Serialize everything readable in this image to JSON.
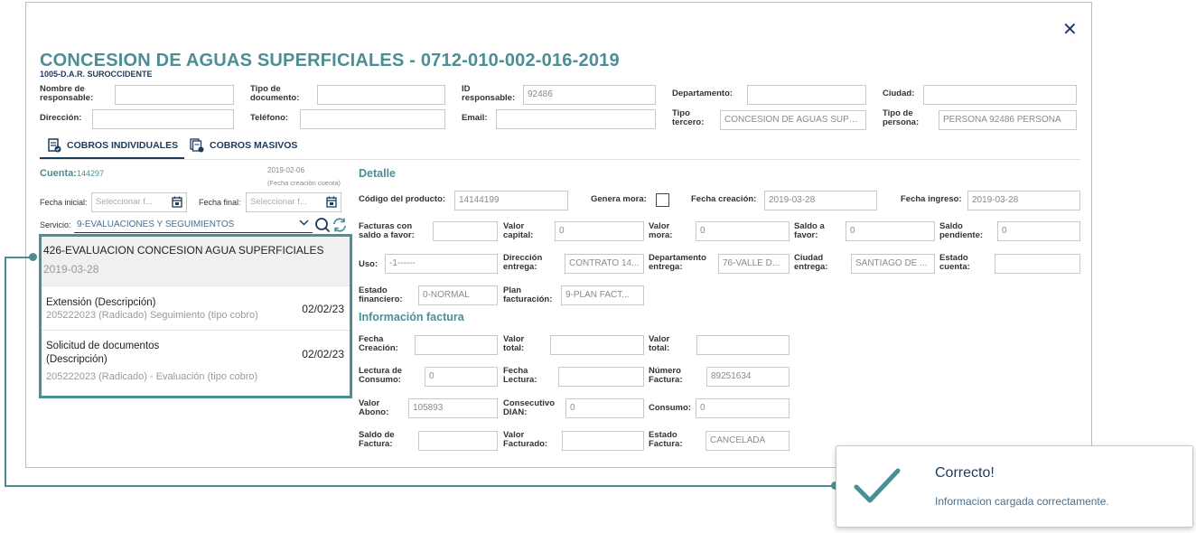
{
  "modal": {
    "title": "CONCESION DE AGUAS SUPERFICIALES - 0712-010-002-016-2019",
    "subtitle": "1005-D.A.R. SUROCCIDENTE",
    "close_icon": "close-icon"
  },
  "header_fields": {
    "nombre_responsable": {
      "label1": "Nombre de",
      "label2": "responsable:",
      "value": ""
    },
    "tipo_documento": {
      "label1": "Tipo de",
      "label2": "documento:",
      "value": ""
    },
    "id_responsable": {
      "label1": "ID",
      "label2": "responsable:",
      "value": "92486"
    },
    "departamento": {
      "label": "Departamento:",
      "value": ""
    },
    "ciudad": {
      "label": "Ciudad:",
      "value": ""
    },
    "direccion": {
      "label": "Dirección:",
      "value": ""
    },
    "telefono": {
      "label": "Teléfono:",
      "value": ""
    },
    "email": {
      "label": "Email:",
      "value": ""
    },
    "tipo_tercero": {
      "label1": "Tipo",
      "label2": "tercero:",
      "value": "CONCESION DE AGUAS SUPERFICIALES"
    },
    "tipo_persona": {
      "label1": "Tipo de",
      "label2": "persona:",
      "value": "PERSONA 92486 PERSONA"
    }
  },
  "tabs": [
    {
      "label": "COBROS INDIVIDUALES",
      "icon": "invoice-check-icon",
      "active": true
    },
    {
      "label": "COBROS MASIVOS",
      "icon": "invoice-stack-icon",
      "active": false
    }
  ],
  "left_panel": {
    "cuenta_label": "Cuenta:",
    "cuenta_value": "144297",
    "fecha_creacion_cuenta": "2019-02-06",
    "fecha_creacion_cuenta_label": "(Fecha creación cuenta)",
    "fecha_inicial_label": "Fecha inicial:",
    "fecha_inicial_placeholder": "Seleccionar f...",
    "fecha_final_label": "Fecha final:",
    "fecha_final_placeholder": "Seleccionar f...",
    "servicio_label": "Servicio:",
    "servicio_value": "9-EVALUACIONES Y SEGUIMIENTOS",
    "items": [
      {
        "title": "426-EVALUACION CONCESION AGUA SUPERFICIALES",
        "sub": "2019-03-28"
      },
      {
        "title": "Extensión (Descripción)",
        "sub": "205222023 (Radicado) Seguimiento (tipo cobro)",
        "date": "02/02/23"
      },
      {
        "title": "Solicitud de documentos",
        "title2": "(Descripción)",
        "sub": "205222023 (Radicado) - Evaluación (tipo cobro)",
        "date": "02/02/23"
      }
    ]
  },
  "detalle": {
    "title": "Detalle",
    "codigo_producto": {
      "label": "Código del producto:",
      "value": "14144199"
    },
    "genera_mora": {
      "label": "Genera mora:"
    },
    "fecha_creacion": {
      "label": "Fecha creación:",
      "value": "2019-03-28"
    },
    "fecha_ingreso": {
      "label": "Fecha ingreso:",
      "value": "2019-03-28"
    },
    "facturas_saldo": {
      "label1": "Facturas con",
      "label2": "saldo a favor:",
      "value": ""
    },
    "valor_capital": {
      "label1": "Valor",
      "label2": "capital:",
      "value": "0"
    },
    "valor_mora": {
      "label1": "Valor",
      "label2": "mora:",
      "value": "0"
    },
    "saldo_favor": {
      "label1": "Saldo a",
      "label2": "favor:",
      "value": "0"
    },
    "saldo_pendiente": {
      "label1": "Saldo",
      "label2": "pendiente:",
      "value": "0"
    },
    "uso": {
      "label": "Uso:",
      "value": "-1------"
    },
    "direccion_entrega": {
      "label1": "Dirección",
      "label2": "entrega:",
      "value": "CONTRATO 14..."
    },
    "departamento_entrega": {
      "label1": "Departamento",
      "label2": "entrega:",
      "value": "76-VALLE D..."
    },
    "ciudad_entrega": {
      "label1": "Ciudad",
      "label2": "entrega:",
      "value": "SANTIAGO DE ..."
    },
    "estado_cuenta": {
      "label1": "Estado",
      "label2": "cuenta:",
      "value": ""
    },
    "estado_financiero": {
      "label1": "Estado",
      "label2": "financiero:",
      "value": "0-NORMAL"
    },
    "plan_facturacion": {
      "label1": "Plan",
      "label2": "facturación:",
      "value": "9-PLAN FACT..."
    }
  },
  "factura": {
    "title": "Información factura",
    "fecha_creacion": {
      "label1": "Fecha",
      "label2": "Creación:",
      "value": ""
    },
    "valor_total_1": {
      "label1": "Valor",
      "label2": "total:",
      "value": ""
    },
    "valor_total_2": {
      "label1": "Valor",
      "label2": "total:",
      "value": ""
    },
    "lectura_consumo": {
      "label1": "Lectura de",
      "label2": "Consumo:",
      "value": "0"
    },
    "fecha_lectura": {
      "label1": "Fecha",
      "label2": "Lectura:",
      "value": ""
    },
    "numero_factura": {
      "label1": "Número",
      "label2": "Factura:",
      "value": "89251634"
    },
    "valor_abono": {
      "label1": "Valor",
      "label2": "Abono:",
      "value": "105893"
    },
    "consecutivo_dian": {
      "label1": "Consecutivo",
      "label2": "DIAN:",
      "value": "0"
    },
    "consumo": {
      "label": "Consumo:",
      "value": "0"
    },
    "saldo_factura": {
      "label1": "Saldo de",
      "label2": "Factura:",
      "value": ""
    },
    "valor_facturado": {
      "label1": "Valor",
      "label2": "Facturado:",
      "value": ""
    },
    "estado_factura": {
      "label1": "Estado",
      "label2": "Factura:",
      "value": "CANCELADA"
    }
  },
  "toast": {
    "title": "Correcto!",
    "message": "Informacion cargada correctamente.",
    "icon": "checkmark-icon"
  },
  "colors": {
    "accent": "#4b8f94",
    "navy": "#1d3a5c"
  }
}
